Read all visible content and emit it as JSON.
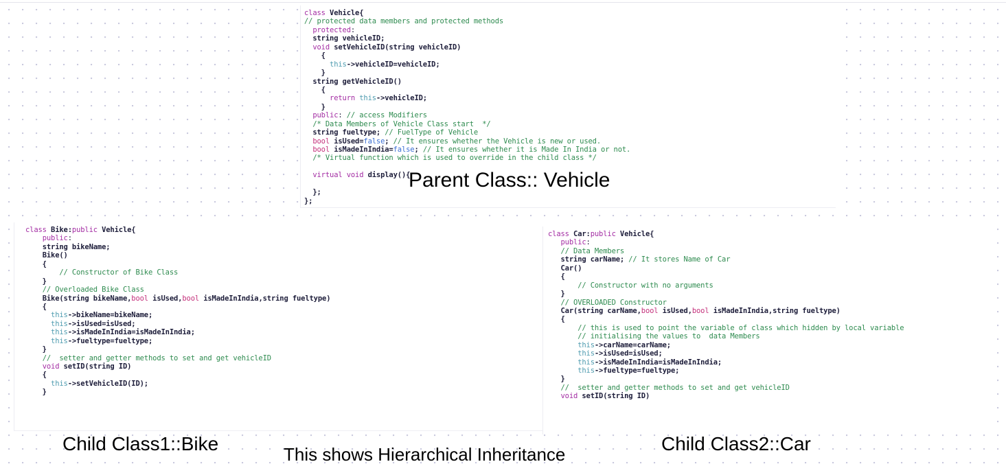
{
  "board": {
    "background_color": "#ffffff",
    "dot_color": "#c9c9de"
  },
  "syntax_colors": {
    "keyword": "#a32ca3",
    "type_keyword": "#c4307b",
    "comment": "#2e8b4f",
    "this_pointer": "#4f9cb0",
    "literal": "#3b6fd4",
    "identifier": "#1d1d3a"
  },
  "annotations": {
    "parent": "Parent Class:: Vehicle",
    "child1": "Child Class1::Bike",
    "child2": "Child Class2::Car",
    "caption": "This shows  Hierarchical Inheritance"
  },
  "panels": {
    "vehicle": {
      "name": "Vehicle",
      "lines": [
        [
          {
            "t": "class ",
            "c": "kw"
          },
          {
            "t": "Vehicle{",
            "c": "id"
          }
        ],
        [
          {
            "t": "// protected data members and protected methods",
            "c": "cmt"
          }
        ],
        [
          {
            "t": "  ",
            "c": "pl"
          },
          {
            "t": "protected",
            "c": "kw"
          },
          {
            "t": ":",
            "c": "pl"
          }
        ],
        [
          {
            "t": "  ",
            "c": "pl"
          },
          {
            "t": "string vehicleID;",
            "c": "id"
          }
        ],
        [
          {
            "t": "  ",
            "c": "pl"
          },
          {
            "t": "void",
            "c": "kw"
          },
          {
            "t": " setVehicleID(string vehicleID)",
            "c": "id"
          }
        ],
        [
          {
            "t": "    {",
            "c": "id"
          }
        ],
        [
          {
            "t": "      ",
            "c": "pl"
          },
          {
            "t": "this",
            "c": "this"
          },
          {
            "t": "->vehicleID=vehicleID;",
            "c": "id"
          }
        ],
        [
          {
            "t": "    }",
            "c": "id"
          }
        ],
        [
          {
            "t": "  ",
            "c": "pl"
          },
          {
            "t": "string getVehicleID()",
            "c": "id"
          }
        ],
        [
          {
            "t": "    {",
            "c": "id"
          }
        ],
        [
          {
            "t": "      ",
            "c": "pl"
          },
          {
            "t": "return ",
            "c": "kw"
          },
          {
            "t": "this",
            "c": "this"
          },
          {
            "t": "->vehicleID;",
            "c": "id"
          }
        ],
        [
          {
            "t": "    }",
            "c": "id"
          }
        ],
        [
          {
            "t": "  ",
            "c": "pl"
          },
          {
            "t": "public",
            "c": "kw"
          },
          {
            "t": ": ",
            "c": "pl"
          },
          {
            "t": "// access Modifiers",
            "c": "cmt"
          }
        ],
        [
          {
            "t": "  ",
            "c": "pl"
          },
          {
            "t": "/* Data Members of Vehicle Class start  */",
            "c": "cmt"
          }
        ],
        [
          {
            "t": "  ",
            "c": "pl"
          },
          {
            "t": "string fueltype; ",
            "c": "id"
          },
          {
            "t": "// FuelType of Vehicle",
            "c": "cmt"
          }
        ],
        [
          {
            "t": "  ",
            "c": "pl"
          },
          {
            "t": "bool",
            "c": "kw2"
          },
          {
            "t": " isUsed=",
            "c": "id"
          },
          {
            "t": "false",
            "c": "lit"
          },
          {
            "t": "; ",
            "c": "id"
          },
          {
            "t": "// It ensures whether the Vehicle is new or used.",
            "c": "cmt"
          }
        ],
        [
          {
            "t": "  ",
            "c": "pl"
          },
          {
            "t": "bool",
            "c": "kw2"
          },
          {
            "t": " isMadeInIndia=",
            "c": "id"
          },
          {
            "t": "false",
            "c": "lit"
          },
          {
            "t": "; ",
            "c": "id"
          },
          {
            "t": "// It ensures whether it is Made In India or not.",
            "c": "cmt"
          }
        ],
        [
          {
            "t": "  ",
            "c": "pl"
          },
          {
            "t": "/* Virtual function which is used to override in the child class */",
            "c": "cmt"
          }
        ],
        [],
        [
          {
            "t": "  ",
            "c": "pl"
          },
          {
            "t": "virtual void",
            "c": "kw"
          },
          {
            "t": " display(){",
            "c": "id"
          }
        ],
        [],
        [
          {
            "t": "  };",
            "c": "id"
          }
        ],
        [
          {
            "t": "};",
            "c": "id"
          }
        ]
      ]
    },
    "bike": {
      "name": "Bike",
      "lines": [
        [
          {
            "t": "class ",
            "c": "kw"
          },
          {
            "t": "Bike:",
            "c": "id"
          },
          {
            "t": "public",
            "c": "kw"
          },
          {
            "t": " Vehicle{",
            "c": "id"
          }
        ],
        [
          {
            "t": "    ",
            "c": "pl"
          },
          {
            "t": "public",
            "c": "kw"
          },
          {
            "t": ":",
            "c": "pl"
          }
        ],
        [
          {
            "t": "    ",
            "c": "pl"
          },
          {
            "t": "string bikeName;",
            "c": "id"
          }
        ],
        [
          {
            "t": "    ",
            "c": "pl"
          },
          {
            "t": "Bike()",
            "c": "id"
          }
        ],
        [
          {
            "t": "    {",
            "c": "id"
          }
        ],
        [
          {
            "t": "        ",
            "c": "pl"
          },
          {
            "t": "// Constructor of Bike Class",
            "c": "cmt"
          }
        ],
        [
          {
            "t": "    }",
            "c": "id"
          }
        ],
        [
          {
            "t": "    ",
            "c": "pl"
          },
          {
            "t": "// Overloaded Bike Class",
            "c": "cmt"
          }
        ],
        [
          {
            "t": "    ",
            "c": "pl"
          },
          {
            "t": "Bike(string bikeName,",
            "c": "id"
          },
          {
            "t": "bool",
            "c": "kw2"
          },
          {
            "t": " isUsed,",
            "c": "id"
          },
          {
            "t": "bool",
            "c": "kw2"
          },
          {
            "t": " isMadeInIndia,string fueltype)",
            "c": "id"
          }
        ],
        [
          {
            "t": "    {",
            "c": "id"
          }
        ],
        [
          {
            "t": "      ",
            "c": "pl"
          },
          {
            "t": "this",
            "c": "this"
          },
          {
            "t": "->bikeName=bikeName;",
            "c": "id"
          }
        ],
        [
          {
            "t": "      ",
            "c": "pl"
          },
          {
            "t": "this",
            "c": "this"
          },
          {
            "t": "->isUsed=isUsed;",
            "c": "id"
          }
        ],
        [
          {
            "t": "      ",
            "c": "pl"
          },
          {
            "t": "this",
            "c": "this"
          },
          {
            "t": "->isMadeInIndia=isMadeInIndia;",
            "c": "id"
          }
        ],
        [
          {
            "t": "      ",
            "c": "pl"
          },
          {
            "t": "this",
            "c": "this"
          },
          {
            "t": "->fueltype=fueltype;",
            "c": "id"
          }
        ],
        [
          {
            "t": "    }",
            "c": "id"
          }
        ],
        [
          {
            "t": "    ",
            "c": "pl"
          },
          {
            "t": "//  setter and getter methods to set and get vehicleID",
            "c": "cmt"
          }
        ],
        [
          {
            "t": "    ",
            "c": "pl"
          },
          {
            "t": "void",
            "c": "kw"
          },
          {
            "t": " setID(string ID)",
            "c": "id"
          }
        ],
        [
          {
            "t": "    {",
            "c": "id"
          }
        ],
        [
          {
            "t": "      ",
            "c": "pl"
          },
          {
            "t": "this",
            "c": "this"
          },
          {
            "t": "->setVehicleID(ID);",
            "c": "id"
          }
        ],
        [
          {
            "t": "    }",
            "c": "id"
          }
        ]
      ]
    },
    "car": {
      "name": "Car",
      "lines": [
        [
          {
            "t": "class ",
            "c": "kw"
          },
          {
            "t": "Car:",
            "c": "id"
          },
          {
            "t": "public",
            "c": "kw"
          },
          {
            "t": " Vehicle{",
            "c": "id"
          }
        ],
        [
          {
            "t": "   ",
            "c": "pl"
          },
          {
            "t": "public",
            "c": "kw"
          },
          {
            "t": ":",
            "c": "pl"
          }
        ],
        [
          {
            "t": "   ",
            "c": "pl"
          },
          {
            "t": "// Data Members",
            "c": "cmt"
          }
        ],
        [
          {
            "t": "   ",
            "c": "pl"
          },
          {
            "t": "string carName; ",
            "c": "id"
          },
          {
            "t": "// It stores Name of Car",
            "c": "cmt"
          }
        ],
        [
          {
            "t": "   ",
            "c": "pl"
          },
          {
            "t": "Car()",
            "c": "id"
          }
        ],
        [
          {
            "t": "   {",
            "c": "id"
          }
        ],
        [
          {
            "t": "       ",
            "c": "pl"
          },
          {
            "t": "// Constructor with no arguments",
            "c": "cmt"
          }
        ],
        [
          {
            "t": "   }",
            "c": "id"
          }
        ],
        [
          {
            "t": "   ",
            "c": "pl"
          },
          {
            "t": "// OVERLOADED Constructor",
            "c": "cmt"
          }
        ],
        [
          {
            "t": "   ",
            "c": "pl"
          },
          {
            "t": "Car(string carName,",
            "c": "id"
          },
          {
            "t": "bool",
            "c": "kw2"
          },
          {
            "t": " isUsed,",
            "c": "id"
          },
          {
            "t": "bool",
            "c": "kw2"
          },
          {
            "t": " isMadeInIndia,string fueltype)",
            "c": "id"
          }
        ],
        [
          {
            "t": "   {",
            "c": "id"
          }
        ],
        [
          {
            "t": "       ",
            "c": "pl"
          },
          {
            "t": "// this is used to point the variable of class which hidden by local variable",
            "c": "cmt"
          }
        ],
        [
          {
            "t": "       ",
            "c": "pl"
          },
          {
            "t": "// initialising the values to  data Members",
            "c": "cmt"
          }
        ],
        [
          {
            "t": "       ",
            "c": "pl"
          },
          {
            "t": "this",
            "c": "this"
          },
          {
            "t": "->carName=carName;",
            "c": "id"
          }
        ],
        [
          {
            "t": "       ",
            "c": "pl"
          },
          {
            "t": "this",
            "c": "this"
          },
          {
            "t": "->isUsed=isUsed;",
            "c": "id"
          }
        ],
        [
          {
            "t": "       ",
            "c": "pl"
          },
          {
            "t": "this",
            "c": "this"
          },
          {
            "t": "->isMadeInIndia=isMadeInIndia;",
            "c": "id"
          }
        ],
        [
          {
            "t": "       ",
            "c": "pl"
          },
          {
            "t": "this",
            "c": "this"
          },
          {
            "t": "->fueltype=fueltype;",
            "c": "id"
          }
        ],
        [
          {
            "t": "   }",
            "c": "id"
          }
        ],
        [
          {
            "t": "   ",
            "c": "pl"
          },
          {
            "t": "//  setter and getter methods to set and get vehicleID",
            "c": "cmt"
          }
        ],
        [
          {
            "t": "   ",
            "c": "pl"
          },
          {
            "t": "void",
            "c": "kw"
          },
          {
            "t": " setID(string ID)",
            "c": "id"
          }
        ]
      ]
    }
  }
}
